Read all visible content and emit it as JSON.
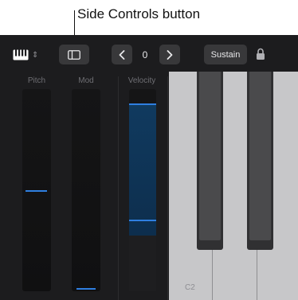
{
  "callout": {
    "text": "Side Controls button"
  },
  "toolbar": {
    "keyboard_icon": "piano-keys-icon",
    "mode_chevron_icon": "up-down-chevron-icon",
    "side_controls_icon": "sidebar-icon",
    "prev_icon": "chevron-left-icon",
    "octave_value": "0",
    "next_icon": "chevron-right-icon",
    "sustain_label": "Sustain",
    "lock_icon": "lock-icon"
  },
  "strips": {
    "pitch_label": "Pitch",
    "mod_label": "Mod",
    "velocity_label": "Velocity",
    "pitch_level": 0.5,
    "mod_level": 0.0,
    "velocity_range": [
      0.27,
      0.85
    ]
  },
  "keyboard": {
    "octave_label": "C2"
  },
  "colors": {
    "background": "#1c1c1e",
    "button": "#38383a",
    "accent_blue": "#2f7fe0",
    "white_key": "#c7c7c9",
    "black_key": "#303032"
  }
}
